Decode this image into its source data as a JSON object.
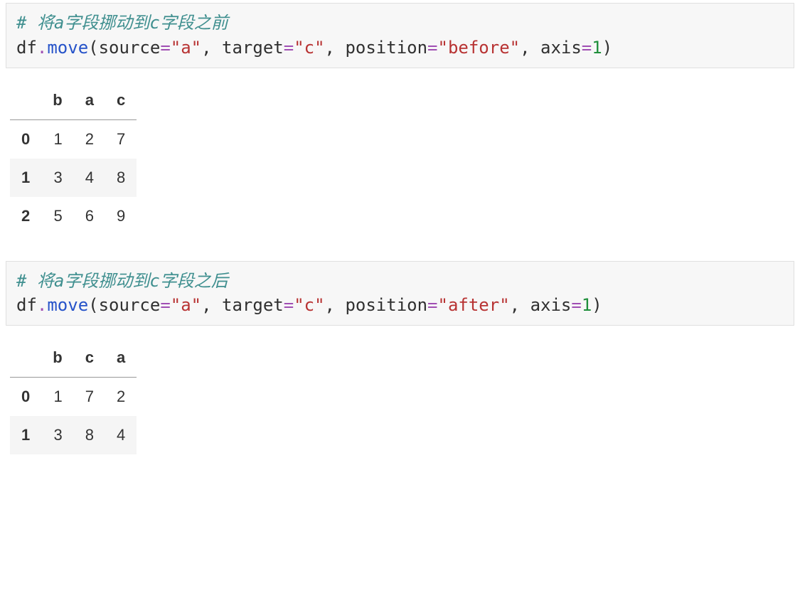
{
  "cell1": {
    "comment_prefix": "# 将",
    "comment_var1": "a",
    "comment_mid1": "字段挪动到",
    "comment_var2": "c",
    "comment_suffix": "字段之前",
    "s_df": "df",
    "s_dot1": ".",
    "s_move": "move",
    "s_lpar": "(",
    "s_source": "source",
    "s_eq1": "=",
    "s_a": "\"a\"",
    "s_c1": ", ",
    "s_target": "target",
    "s_eq2": "=",
    "s_c": "\"c\"",
    "s_c2": ", ",
    "s_position": "position",
    "s_eq3": "=",
    "s_before": "\"before\"",
    "s_c3": ", ",
    "s_axis": "axis",
    "s_eq4": "=",
    "s_one": "1",
    "s_rpar": ")"
  },
  "table1": {
    "columns": [
      "b",
      "a",
      "c"
    ],
    "index": [
      "0",
      "1",
      "2"
    ],
    "data": [
      [
        "1",
        "2",
        "7"
      ],
      [
        "3",
        "4",
        "8"
      ],
      [
        "5",
        "6",
        "9"
      ]
    ]
  },
  "cell2": {
    "comment_prefix": "# 将",
    "comment_var1": "a",
    "comment_mid1": "字段挪动到",
    "comment_var2": "c",
    "comment_suffix": "字段之后",
    "s_df": "df",
    "s_dot1": ".",
    "s_move": "move",
    "s_lpar": "(",
    "s_source": "source",
    "s_eq1": "=",
    "s_a": "\"a\"",
    "s_c1": ", ",
    "s_target": "target",
    "s_eq2": "=",
    "s_c": "\"c\"",
    "s_c2": ", ",
    "s_position": "position",
    "s_eq3": "=",
    "s_after": "\"after\"",
    "s_c3": ", ",
    "s_axis": "axis",
    "s_eq4": "=",
    "s_one": "1",
    "s_rpar": ")"
  },
  "table2": {
    "columns": [
      "b",
      "c",
      "a"
    ],
    "index": [
      "0",
      "1"
    ],
    "data": [
      [
        "1",
        "7",
        "2"
      ],
      [
        "3",
        "8",
        "4"
      ]
    ]
  }
}
